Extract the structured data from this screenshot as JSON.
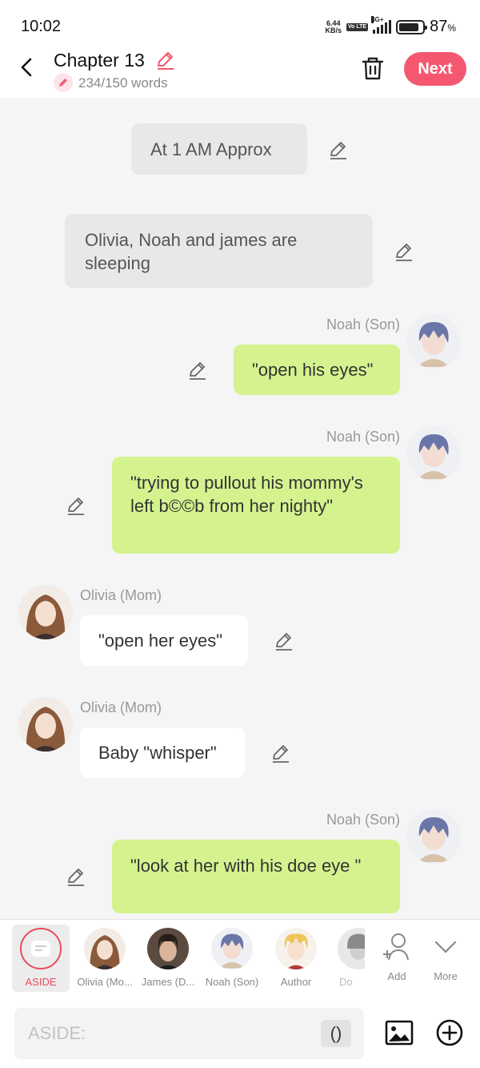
{
  "status": {
    "time": "10:02",
    "net_speed_top": "6.44",
    "net_speed_bottom": "KB/s",
    "volte": "Vo LTE",
    "network": "4G+",
    "battery_pct": "87",
    "battery_unit": "%",
    "battery_level": 0.87
  },
  "header": {
    "title": "Chapter 13",
    "word_count": "234/150 words",
    "next_label": "Next",
    "accent": "#f4576f"
  },
  "messages": [
    {
      "type": "aside",
      "text": "At 1 AM Approx"
    },
    {
      "type": "aside",
      "text": "Olivia, Noah and james are sleeping"
    },
    {
      "type": "right",
      "speaker": "Noah (Son)",
      "text": "\"open his eyes\""
    },
    {
      "type": "right",
      "speaker": "Noah (Son)",
      "text": "\"trying to pullout his mommy's left b©©b from her nighty\""
    },
    {
      "type": "left",
      "speaker": "Olivia (Mom)",
      "text": "\"open her eyes\""
    },
    {
      "type": "left",
      "speaker": "Olivia (Mom)",
      "text": "Baby \"whisper\""
    },
    {
      "type": "right",
      "speaker": "Noah (Son)",
      "text": "\"look at her with his doe eye \""
    }
  ],
  "characters": [
    {
      "label": "ASIDE",
      "selected": true
    },
    {
      "label": "Olivia (Mo..."
    },
    {
      "label": "James (D..."
    },
    {
      "label": "Noah (Son)"
    },
    {
      "label": "Author"
    },
    {
      "label": "Do"
    },
    {
      "label": "Add",
      "icon": "add-user-icon"
    },
    {
      "label": "More",
      "icon": "chevron-down-icon"
    }
  ],
  "input": {
    "placeholder": "ASIDE:",
    "paren_label": "()"
  },
  "colors": {
    "green_bubble": "#d4f38f",
    "aside_bubble": "#e8e8e8",
    "selected_red": "#e94b5d"
  }
}
